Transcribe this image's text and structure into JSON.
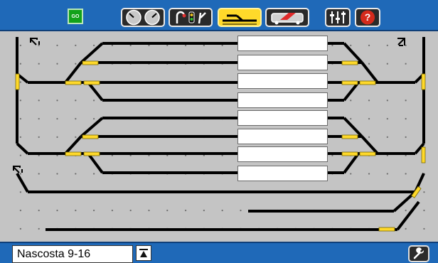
{
  "toolbar": {
    "go_label": "GO",
    "buttons": [
      {
        "icon": "gauges-icon"
      },
      {
        "icon": "signals-icon"
      },
      {
        "icon": "track-layout-icon",
        "active": true
      },
      {
        "icon": "locomotive-icon"
      },
      {
        "icon": "controllers-icon"
      },
      {
        "icon": "help-icon"
      }
    ]
  },
  "layout": {
    "jump_icons": [
      "jump-arrow-icon",
      "jump-arrow-icon",
      "jump-arrow-icon"
    ],
    "track_labels": [
      "",
      "",
      "",
      "",
      "",
      "",
      "",
      ""
    ]
  },
  "footer": {
    "page_name": "Nascosta 9-16",
    "page_up_icon": "page-up-icon",
    "settings_icon": "wrench-icon"
  },
  "colors": {
    "bar": "#1f69b8",
    "switch": "#ffd92a",
    "track": "#000000",
    "go": "#12a21a",
    "help": "#d42a1c"
  }
}
